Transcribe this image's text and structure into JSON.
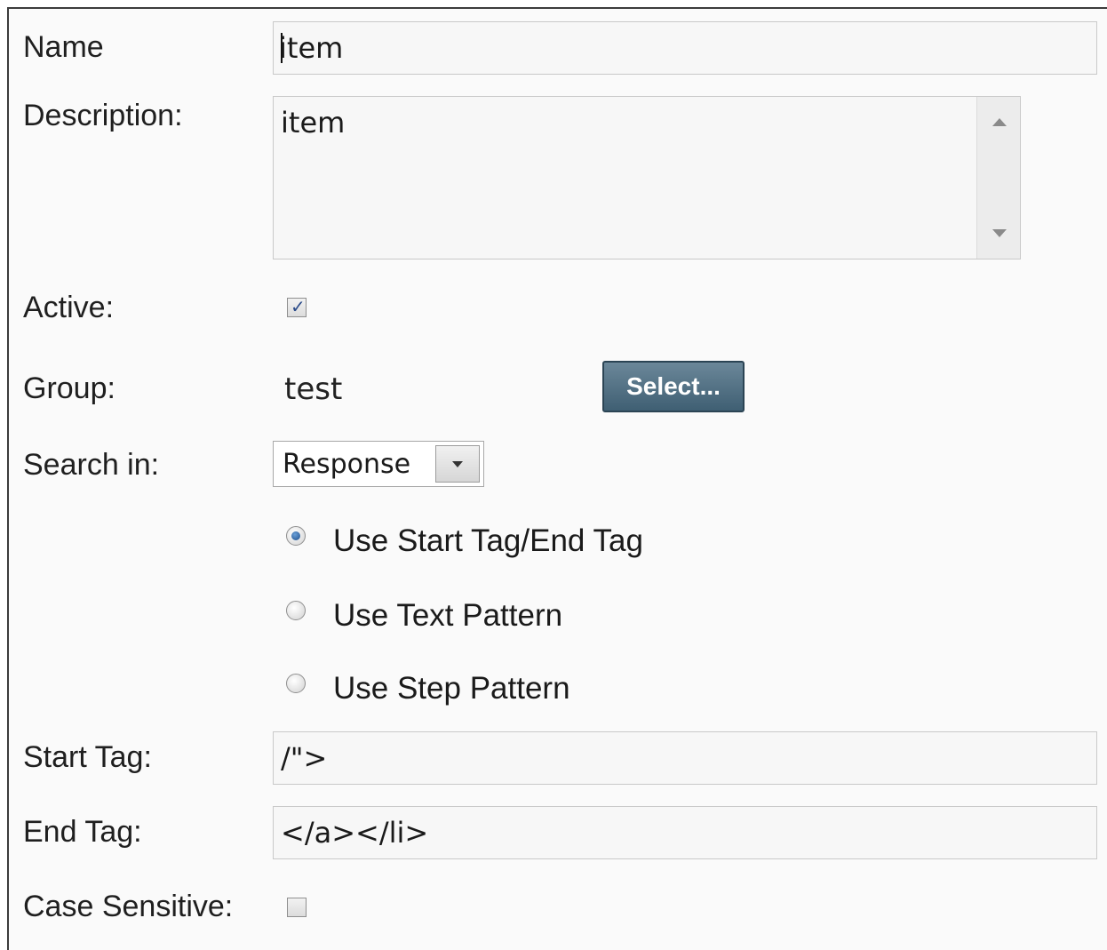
{
  "form": {
    "name_label": "Name",
    "name_value": "item",
    "description_label": "Description:",
    "description_value": "item",
    "active_label": "Active:",
    "active_checked": true,
    "group_label": "Group:",
    "group_value": "test",
    "select_button_label": "Select...",
    "search_in_label": "Search in:",
    "search_in_value": "Response",
    "radio_options": [
      {
        "label": "Use Start Tag/End Tag",
        "checked": true
      },
      {
        "label": "Use Text Pattern",
        "checked": false
      },
      {
        "label": "Use Step Pattern",
        "checked": false
      }
    ],
    "start_tag_label": "Start Tag:",
    "start_tag_value": "/\">",
    "end_tag_label": "End Tag:",
    "end_tag_value": "</a></li>",
    "case_sensitive_label": "Case Sensitive:",
    "case_sensitive_checked": false
  },
  "colors": {
    "button_bg": "#4d6b7e",
    "radio_selected": "#1d4d8a"
  }
}
